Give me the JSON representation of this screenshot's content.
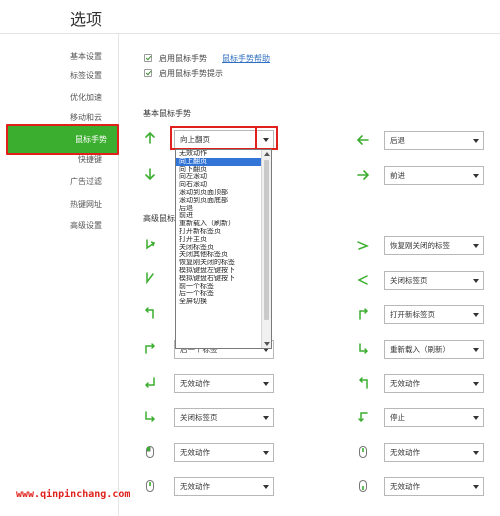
{
  "window": {
    "title": "选项"
  },
  "sidebar": {
    "items": [
      {
        "label": "基本设置"
      },
      {
        "label": "标签设置"
      },
      {
        "label": "优化加速"
      },
      {
        "label": "移动和云"
      },
      {
        "label": "鼠标手势"
      },
      {
        "label": "快捷键"
      },
      {
        "label": "广告过滤"
      },
      {
        "label": "热键网址"
      },
      {
        "label": "高级设置"
      }
    ],
    "active_index": 4
  },
  "options": {
    "enable_gesture": {
      "label": "启用鼠标手势",
      "checked": true
    },
    "help_link": "鼠标手势帮助",
    "enable_tip": {
      "label": "启用鼠标手势提示",
      "checked": true
    }
  },
  "basic": {
    "heading": "基本鼠标手势",
    "up": "向上翻页",
    "left": "后退",
    "down": "",
    "right": "前进"
  },
  "advanced": {
    "heading": "高级鼠标",
    "rows": [
      {
        "left": "",
        "right": "恢复刚关闭的标签"
      },
      {
        "left": "",
        "right": "关闭标签页"
      },
      {
        "left": "",
        "right": "打开新标签页"
      },
      {
        "left": "后一个标签",
        "right": "重新载入（刷新）"
      },
      {
        "left": "无效动作",
        "right": "无效动作"
      },
      {
        "left": "关闭标签页",
        "right": "停止"
      },
      {
        "left": "无效动作",
        "right": "无效动作"
      },
      {
        "left": "无效动作",
        "right": "无效动作"
      }
    ]
  },
  "dropdown": {
    "selected_index": 1,
    "options": [
      "无效动作",
      "向上翻页",
      "向下翻页",
      "向左滚动",
      "向右滚动",
      "滚动到页面顶部",
      "滚动到页面底部",
      "后退",
      "前进",
      "重新载入（刷新）",
      "打开新标签页",
      "打开主页",
      "关闭标签页",
      "关闭其他标签页",
      "恢复刚关闭的标签",
      "模拟键盘左键按下",
      "模拟键盘右键按下",
      "前一个标签",
      "后一个标签",
      "全屏切换"
    ]
  },
  "watermark": "www.qinpinchang.com",
  "colors": {
    "accent": "#3cae2f",
    "highlight": "#e0201a",
    "link": "#2f6fc0",
    "selection": "#3375d6"
  }
}
